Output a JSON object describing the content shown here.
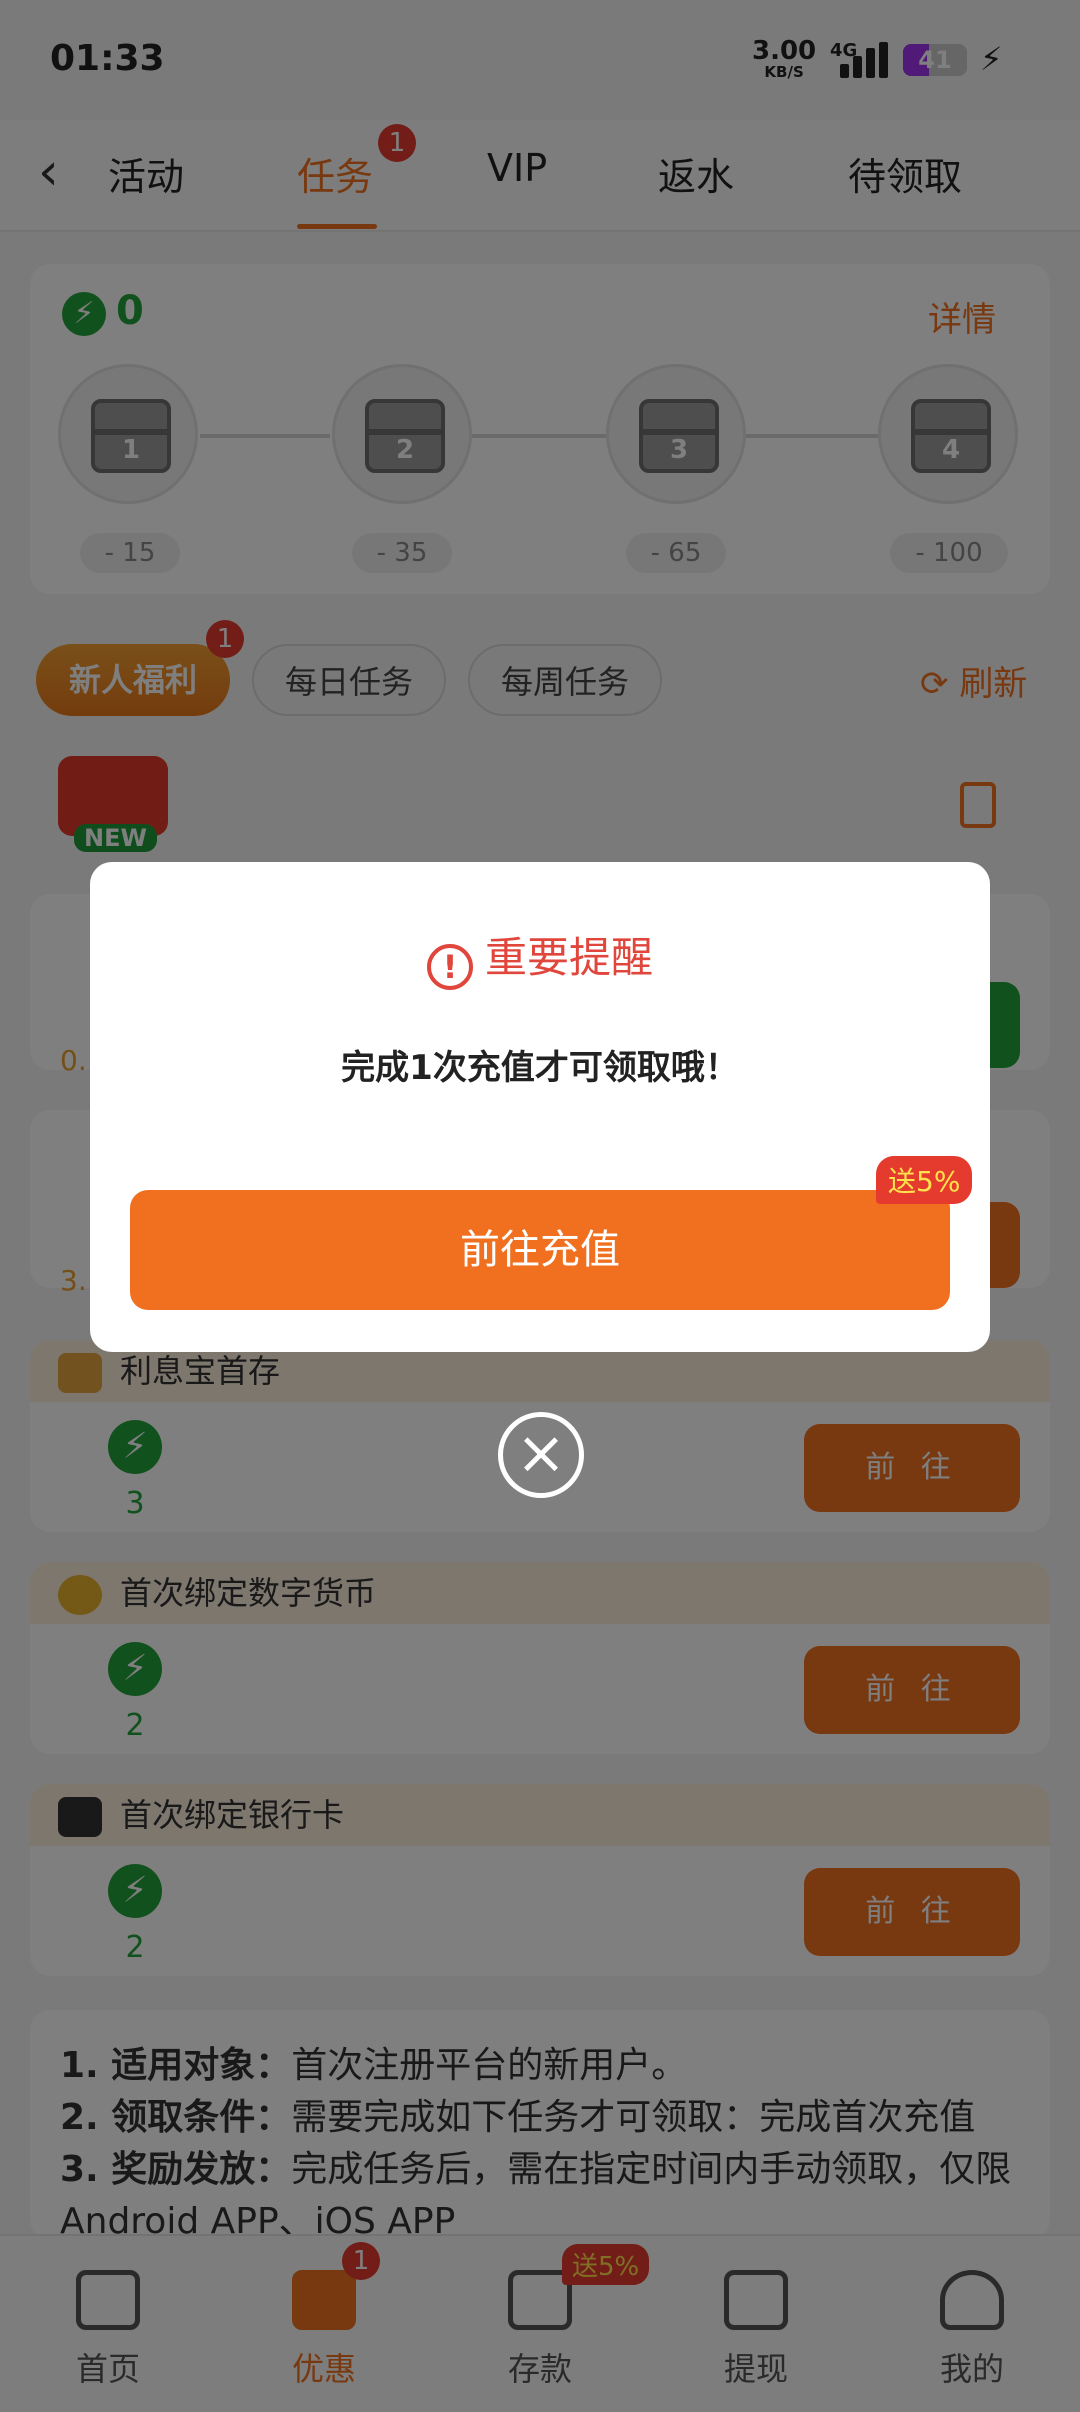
{
  "status": {
    "time": "01:33",
    "speed": "3.00",
    "speed_unit": "KB/S",
    "network": "4G",
    "battery": "41",
    "battery_level": 0.41
  },
  "topnav": {
    "tabs": [
      "活动",
      "任务",
      "VIP",
      "返水",
      "待领取"
    ],
    "active_tab": "任务",
    "badge": "1"
  },
  "progress": {
    "energy": "0",
    "detail_label": "详情",
    "chests": [
      {
        "num": "1",
        "cost": "- 15"
      },
      {
        "num": "2",
        "cost": "- 35"
      },
      {
        "num": "3",
        "cost": "- 65"
      },
      {
        "num": "4",
        "cost": "- 100"
      }
    ]
  },
  "filters": {
    "items": [
      "新人福利",
      "每日任务",
      "每周任务"
    ],
    "badge": "1",
    "refresh_label": "刷新"
  },
  "new_badge": "NEW",
  "tasks": [
    {
      "title": "利息宝首存",
      "reward": "3",
      "button": "前 往"
    },
    {
      "title": "首次绑定数字货币",
      "reward": "2",
      "button": "前 往"
    },
    {
      "title": "首次绑定银行卡",
      "reward": "2",
      "button": "前 往"
    }
  ],
  "partial_values": [
    "0.",
    "3."
  ],
  "rules": [
    {
      "label": "1. 适用对象：",
      "text": "首次注册平台的新用户。"
    },
    {
      "label": "2. 领取条件：",
      "text": "需要完成如下任务才可领取：完成首次充值"
    },
    {
      "label": "3. 奖励发放：",
      "text": "完成任务后，需在指定时间内手动领取，仅限Android APP、iOS APP"
    }
  ],
  "bottomnav": {
    "items": [
      "首页",
      "优惠",
      "存款",
      "提现",
      "我的"
    ],
    "active": "优惠",
    "badge": "1",
    "deposit_tag": "送5%"
  },
  "modal": {
    "title": "重要提醒",
    "message": "完成1次充值才可领取哦！",
    "button": "前往充值",
    "tag": "送5%"
  },
  "colors": {
    "accent": "#f07020",
    "green": "#23a23a",
    "danger": "#e43b2e"
  }
}
